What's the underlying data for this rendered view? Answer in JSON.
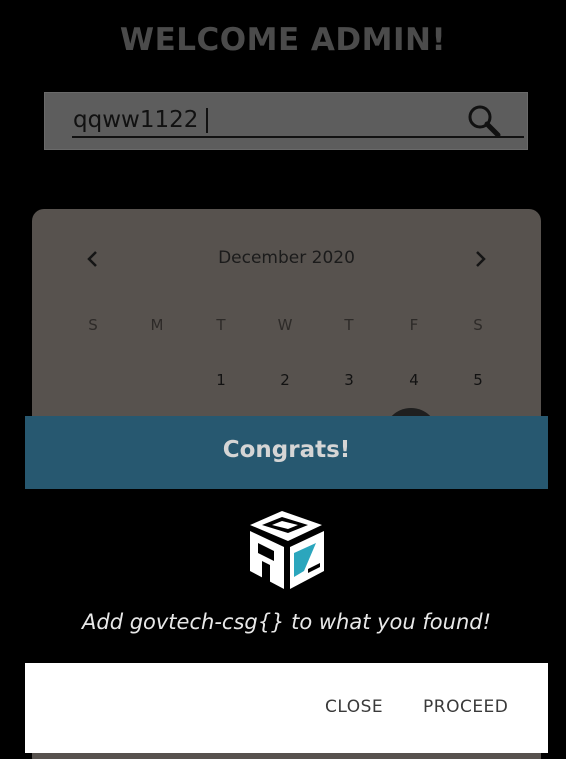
{
  "header": {
    "title": "WELCOME ADMIN!"
  },
  "search": {
    "value": "qqww1122",
    "icon": "search-icon"
  },
  "calendar": {
    "month_label": "December 2020",
    "prev_icon": "chevron-left-icon",
    "next_icon": "chevron-right-icon",
    "weekdays": [
      "S",
      "M",
      "T",
      "W",
      "T",
      "F",
      "S"
    ],
    "first_row_dates": [
      "",
      "",
      "1",
      "2",
      "3",
      "4",
      "5"
    ]
  },
  "modal": {
    "title": "Congrats!",
    "logo": "stack-logo",
    "message": "Add govtech-csg{} to what you found!",
    "close_label": "CLOSE",
    "proceed_label": "PROCEED"
  },
  "colors": {
    "modal_header": "#275870",
    "background": "#000000",
    "calendar_bg": "#57524e",
    "logo_accent": "#2ba6bd"
  }
}
